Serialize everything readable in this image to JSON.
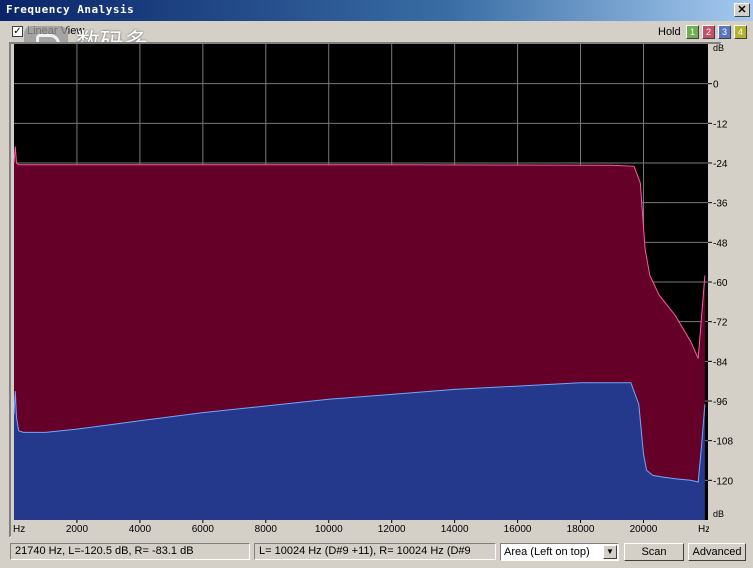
{
  "window": {
    "title": "Frequency Analysis",
    "close_label": "✕"
  },
  "toolbar": {
    "linear_view_label": "Linear View",
    "linear_view_checked": true,
    "hold_label": "Hold",
    "hold_buttons": [
      {
        "label": "1",
        "color": "#6fae52"
      },
      {
        "label": "2",
        "color": "#c5506a"
      },
      {
        "label": "3",
        "color": "#5a74c4"
      },
      {
        "label": "4",
        "color": "#b4b22e"
      }
    ]
  },
  "watermark": {
    "chinese": "数码多",
    "site": "Soomal.com"
  },
  "chart_data": {
    "type": "area",
    "x_unit": "Hz",
    "y_unit": "dB",
    "xlim": [
      0,
      22050
    ],
    "ylim": [
      -132,
      12
    ],
    "x_ticks": [
      2000,
      4000,
      6000,
      8000,
      10000,
      12000,
      14000,
      16000,
      18000,
      20000
    ],
    "x_tick_labels": [
      "2000",
      "4000",
      "6000",
      "8000",
      "10000",
      "12000",
      "14000",
      "16000",
      "18000",
      "20000"
    ],
    "y_ticks": [
      0,
      -12,
      -24,
      -36,
      -48,
      -60,
      -72,
      -84,
      -96,
      -108,
      -120
    ],
    "y_tick_labels": [
      "0",
      "-12",
      "-24",
      "-36",
      "-48",
      "-60",
      "-72",
      "-84",
      "-96",
      "-108",
      "-120"
    ],
    "grid": true,
    "colors": {
      "background": "#000000",
      "grid": "#7a7a7a",
      "left": "#650028",
      "left_line": "#ff5aa0",
      "right": "#24388c",
      "right_line": "#6ea8ff"
    },
    "series": [
      {
        "channel": "L",
        "x": [
          0,
          40,
          80,
          150,
          300,
          1000,
          4000,
          8000,
          12000,
          16000,
          19000,
          19700,
          19900,
          20050,
          20200,
          20500,
          21000,
          21500,
          21740,
          21850,
          21950
        ],
        "y": [
          -24,
          -19,
          -24,
          -24.5,
          -24.5,
          -24.5,
          -24.5,
          -24.5,
          -24.5,
          -24.6,
          -24.7,
          -25,
          -30,
          -50,
          -58,
          -64,
          -70,
          -78,
          -83.1,
          -70,
          -58
        ]
      },
      {
        "channel": "R",
        "x": [
          0,
          40,
          80,
          150,
          300,
          500,
          1000,
          2000,
          4000,
          6000,
          8000,
          10000,
          12000,
          14000,
          16000,
          18000,
          19600,
          19850,
          20000,
          20100,
          20300,
          20600,
          21000,
          21500,
          21740,
          21850,
          21950
        ],
        "y": [
          -100,
          -93,
          -101,
          -105,
          -105.5,
          -105.5,
          -105.5,
          -104.5,
          -102,
          -99.5,
          -97.5,
          -95.5,
          -94,
          -92.5,
          -91.5,
          -90.5,
          -90.5,
          -97,
          -112,
          -117,
          -118.5,
          -119,
          -119.5,
          -120,
          -120.5,
          -109,
          -97
        ]
      }
    ]
  },
  "status": {
    "cursor_readout": "21740 Hz, L=-120.5 dB, R= -83.1 dB",
    "peak_readout": "L=  10024 Hz (D#9 +11), R=  10024 Hz (D#9",
    "display_mode": "Area (Left on top)",
    "scan_label": "Scan",
    "advanced_label": "Advanced"
  }
}
